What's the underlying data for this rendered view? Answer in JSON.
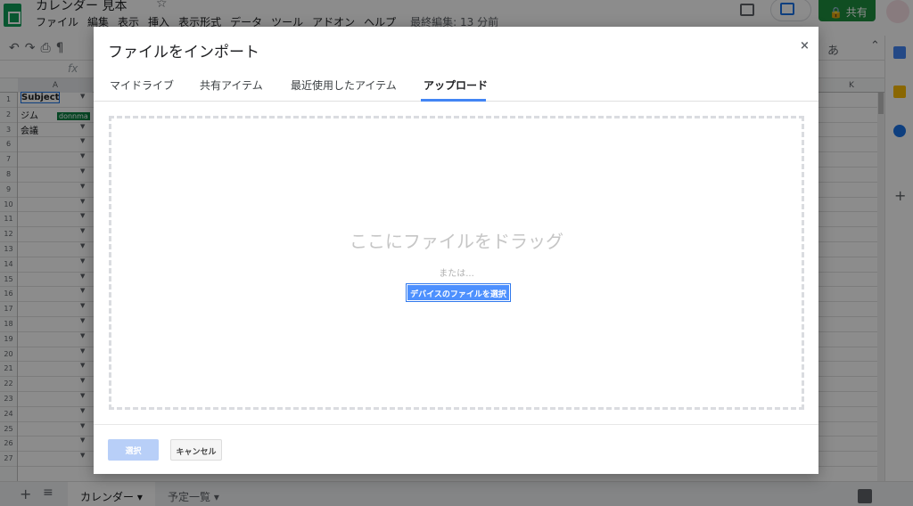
{
  "app": {
    "doc_title": "カレンダー 見本",
    "menu": [
      "ファイル",
      "編集",
      "表示",
      "挿入",
      "表示形式",
      "データ",
      "ツール",
      "アドオン",
      "ヘルプ"
    ],
    "last_edit": "最終編集: 13 分前",
    "share_label": "共有",
    "input_mode": "あ"
  },
  "grid": {
    "columns": [
      "A",
      "K"
    ],
    "rows": [
      "1",
      "2",
      "3",
      "6",
      "7",
      "8",
      "9",
      "10",
      "11",
      "12",
      "13",
      "14",
      "15",
      "16",
      "17",
      "18",
      "19",
      "20",
      "21",
      "22",
      "23",
      "24",
      "25",
      "26",
      "27"
    ],
    "cell_values": [
      "Subject",
      "ジム",
      "会議"
    ],
    "comment_tag": "donnma"
  },
  "sheet_tabs": [
    "カレンダー",
    "予定一覧"
  ],
  "dialog": {
    "title": "ファイルをインポート",
    "close_label": "×",
    "tabs": [
      {
        "label": "マイドライブ",
        "active": false
      },
      {
        "label": "共有アイテム",
        "active": false
      },
      {
        "label": "最近使用したアイテム",
        "active": false
      },
      {
        "label": "アップロード",
        "active": true
      }
    ],
    "drop_text": "ここにファイルをドラッグ",
    "or_text": "または...",
    "select_device_label": "デバイスのファイルを選択",
    "select_label": "選択",
    "cancel_label": "キャンセル"
  },
  "colors": {
    "accent": "#4285f4",
    "primary_button": "#4d90fe",
    "disabled_button": "#b8cff8",
    "share_green": "#1e8e3e"
  }
}
